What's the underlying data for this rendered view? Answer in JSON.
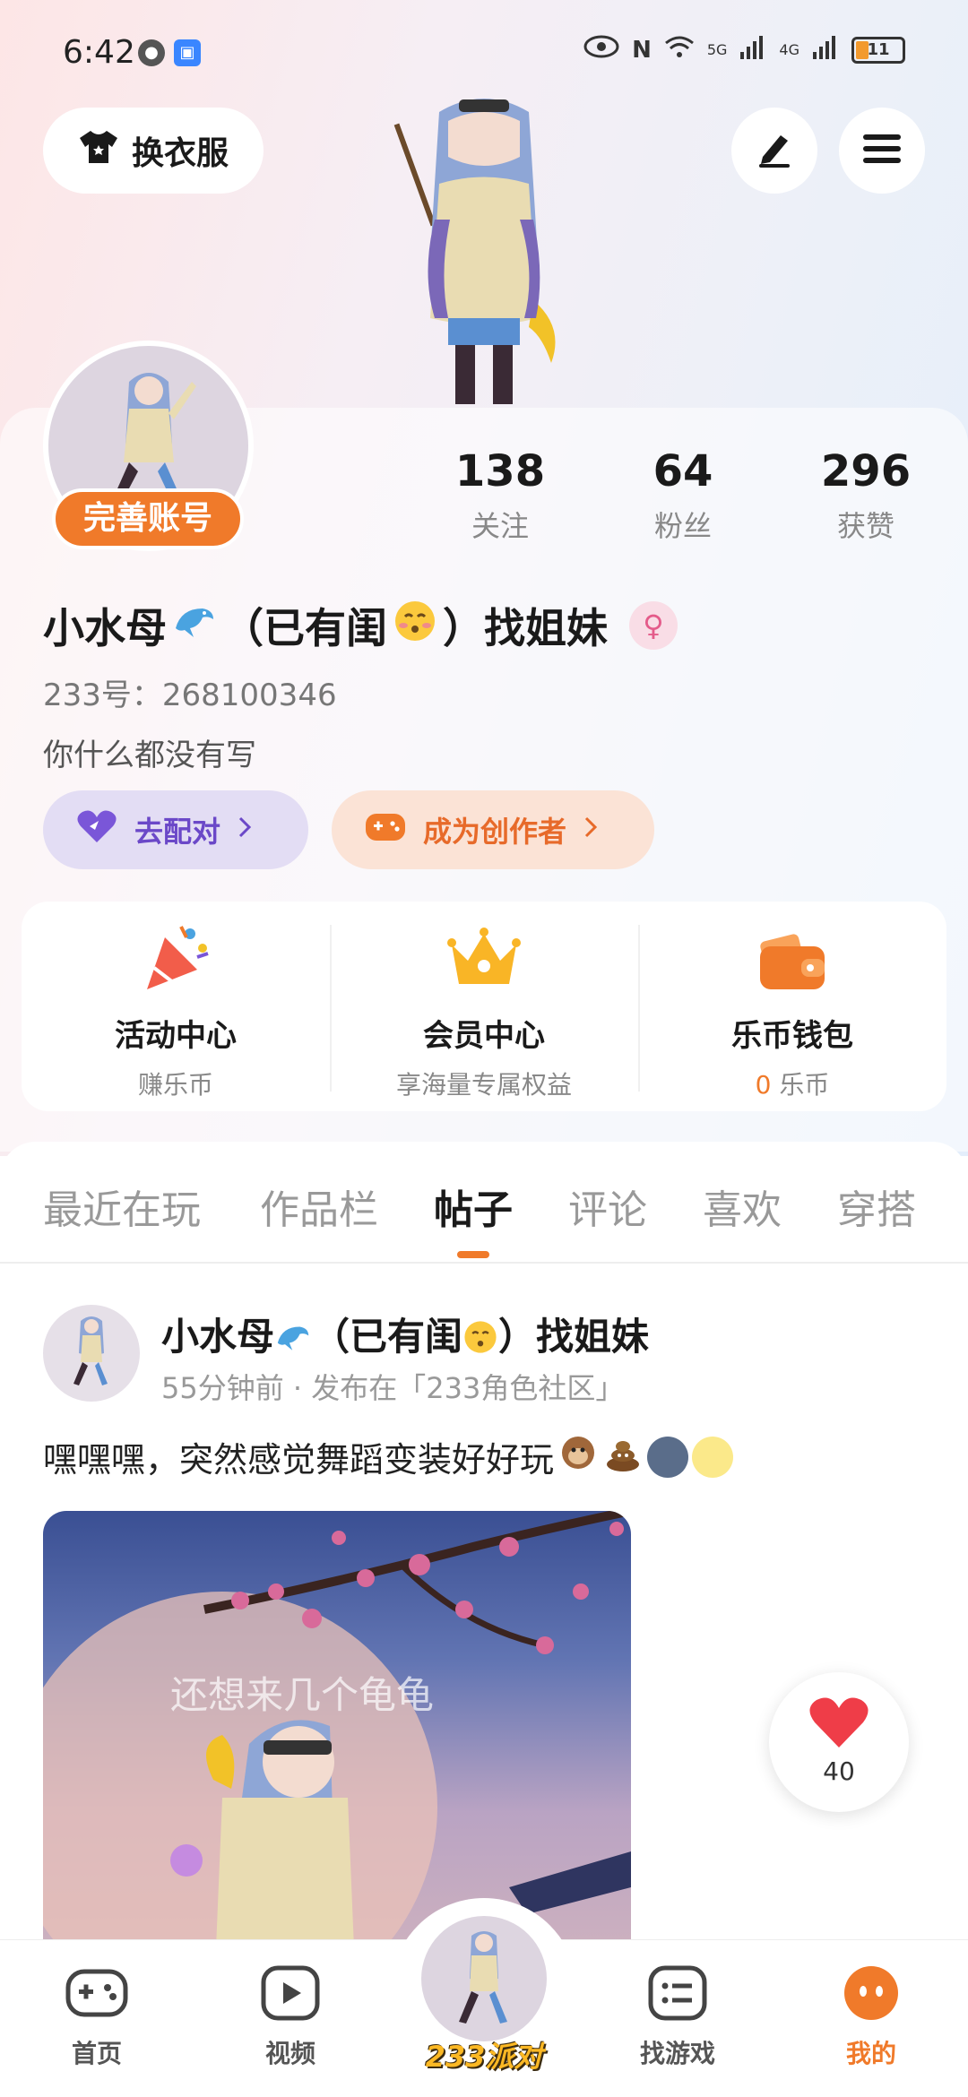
{
  "status_bar": {
    "time": "6:42",
    "network_1": "5G",
    "network_2": "4G",
    "battery": "11"
  },
  "header": {
    "outfit_label": "换衣服",
    "edit_icon": "pencil-icon",
    "menu_icon": "hamburger-icon"
  },
  "profile": {
    "complete_label": "完善账号",
    "stats": [
      {
        "value": "138",
        "label": "关注"
      },
      {
        "value": "64",
        "label": "粉丝"
      },
      {
        "value": "296",
        "label": "获赞"
      }
    ],
    "nickname_part1": "小水母",
    "nickname_part2": "（已有闺",
    "nickname_part3": "）找姐妹",
    "gender_symbol": "♀",
    "uid": "233号：268100346",
    "bio": "你什么都没有写",
    "match_label": "去配对",
    "creator_label": "成为创作者"
  },
  "features": [
    {
      "title": "活动中心",
      "subtitle": "赚乐币"
    },
    {
      "title": "会员中心",
      "subtitle": "享海量专属权益"
    },
    {
      "title": "乐币钱包",
      "coin_amount": "0",
      "coin_unit": "乐币"
    }
  ],
  "tabs": [
    {
      "label": "最近在玩"
    },
    {
      "label": "作品栏"
    },
    {
      "label": "帖子"
    },
    {
      "label": "评论"
    },
    {
      "label": "喜欢"
    },
    {
      "label": "穿搭"
    }
  ],
  "post": {
    "author_part1": "小水母",
    "author_part2": "（已有闺",
    "author_part3": "）找姐妹",
    "meta": "55分钟前 · 发布在「233角色社区」",
    "text": "嘿嘿嘿，突然感觉舞蹈变装好好玩",
    "image_overlay_text": "还想来几个龟龟",
    "like_count": "40"
  },
  "bottom_nav": [
    {
      "label": "首页"
    },
    {
      "label": "视频"
    },
    {
      "label": "233派对"
    },
    {
      "label": "找游戏"
    },
    {
      "label": "我的"
    }
  ],
  "colors": {
    "accent": "#f07a2a",
    "match_purple": "#6b48c8",
    "like_red": "#ef3d48"
  }
}
